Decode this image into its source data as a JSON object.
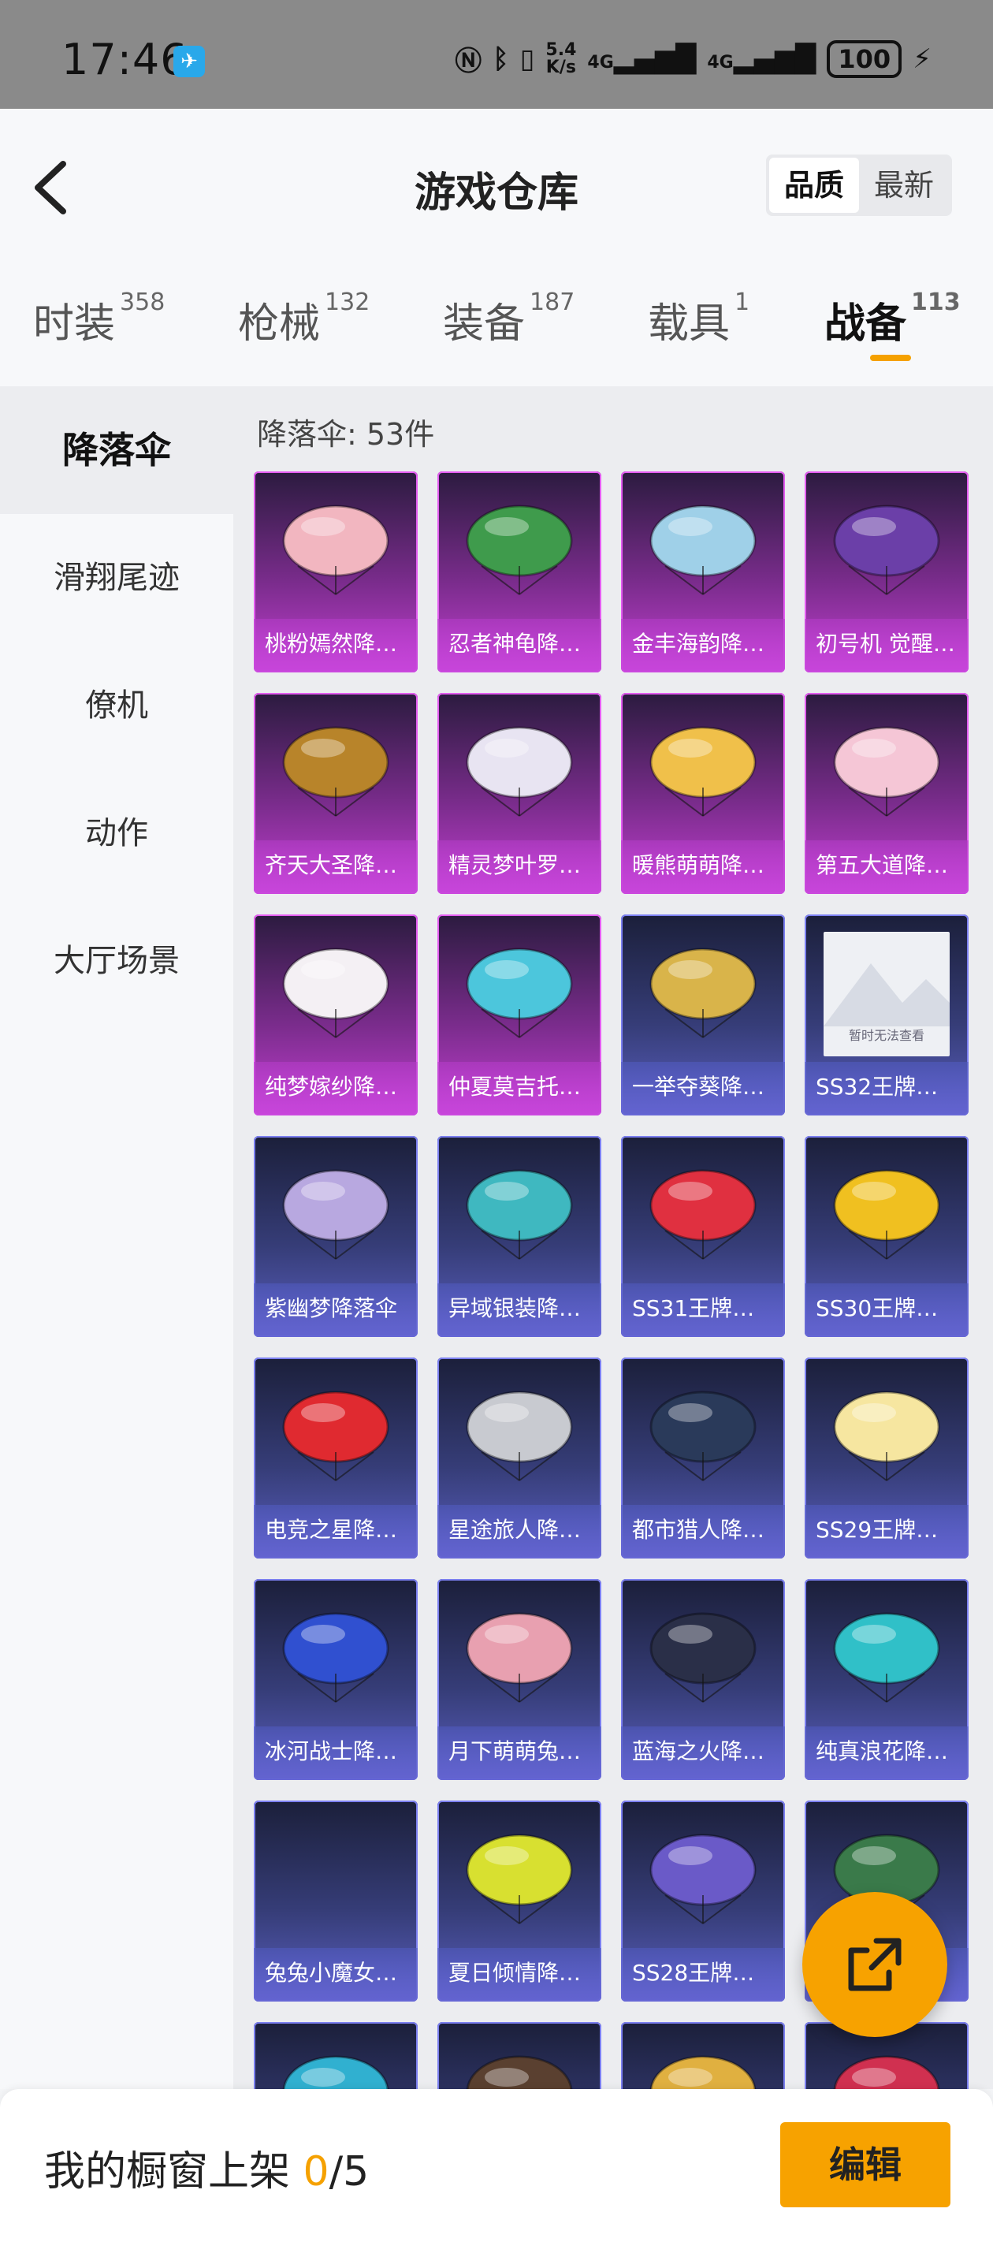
{
  "status_bar": {
    "time": "17:46",
    "net_speed_value": "5.4",
    "net_speed_unit": "K/s",
    "signal1": "4G",
    "signal2": "4G",
    "battery": "100"
  },
  "header": {
    "title": "游戏仓库",
    "sort_options": [
      "品质",
      "最新"
    ],
    "sort_active": "品质"
  },
  "tabs": [
    {
      "label": "时装",
      "count": "358"
    },
    {
      "label": "枪械",
      "count": "132"
    },
    {
      "label": "装备",
      "count": "187"
    },
    {
      "label": "载具",
      "count": "1"
    },
    {
      "label": "战备",
      "count": "113",
      "active": true
    }
  ],
  "sidebar": {
    "items": [
      {
        "label": "降落伞",
        "active": true
      },
      {
        "label": "滑翔尾迹"
      },
      {
        "label": "僚机"
      },
      {
        "label": "动作"
      },
      {
        "label": "大厅场景"
      }
    ]
  },
  "content": {
    "count_label": "降落伞: 53件",
    "placeholder_text": "暂时无法查看",
    "items": [
      {
        "name": "桃粉嫣然降…",
        "rarity": "purple",
        "color": "#f2b6c0"
      },
      {
        "name": "忍者神龟降…",
        "rarity": "purple",
        "color": "#3f9b4c"
      },
      {
        "name": "金丰海韵降…",
        "rarity": "purple",
        "color": "#9fd0e8"
      },
      {
        "name": "初号机 觉醒…",
        "rarity": "purple",
        "color": "#6b3fa8"
      },
      {
        "name": "齐天大圣降…",
        "rarity": "purple",
        "color": "#b8842a"
      },
      {
        "name": "精灵梦叶罗…",
        "rarity": "purple",
        "color": "#e8e4f2"
      },
      {
        "name": "暖熊萌萌降…",
        "rarity": "purple",
        "color": "#f0c04a"
      },
      {
        "name": "第五大道降…",
        "rarity": "purple",
        "color": "#f5c6d6"
      },
      {
        "name": "纯梦嫁纱降…",
        "rarity": "purple",
        "color": "#f4f0f4"
      },
      {
        "name": "仲夏莫吉托…",
        "rarity": "purple",
        "color": "#4cc6dc"
      },
      {
        "name": "一举夺葵降…",
        "rarity": "blue",
        "color": "#d9b44a"
      },
      {
        "name": "SS32王牌降…",
        "rarity": "blue",
        "placeholder": true
      },
      {
        "name": "紫幽梦降落伞",
        "rarity": "blue",
        "color": "#b8a8e0"
      },
      {
        "name": "异域银装降…",
        "rarity": "blue",
        "color": "#3fb8c0"
      },
      {
        "name": "SS31王牌降…",
        "rarity": "blue",
        "color": "#e03040"
      },
      {
        "name": "SS30王牌降…",
        "rarity": "blue",
        "color": "#f0c020"
      },
      {
        "name": "电竞之星降…",
        "rarity": "blue",
        "color": "#e02a30"
      },
      {
        "name": "星途旅人降…",
        "rarity": "blue",
        "color": "#c8cad0"
      },
      {
        "name": "都市猎人降…",
        "rarity": "blue",
        "color": "#2a3a5a"
      },
      {
        "name": "SS29王牌降…",
        "rarity": "blue",
        "color": "#f6e6a0"
      },
      {
        "name": "冰河战士降…",
        "rarity": "blue",
        "color": "#3050d0"
      },
      {
        "name": "月下萌萌兔…",
        "rarity": "blue",
        "color": "#e8a0b0"
      },
      {
        "name": "蓝海之火降…",
        "rarity": "blue",
        "color": "#2a2f48"
      },
      {
        "name": "纯真浪花降…",
        "rarity": "blue",
        "color": "#30c0c8"
      },
      {
        "name": "兔兔小魔女…",
        "rarity": "blue",
        "color": ""
      },
      {
        "name": "夏日倾情降…",
        "rarity": "blue",
        "color": "#d8e030"
      },
      {
        "name": "SS28王牌降…",
        "rarity": "blue",
        "color": "#6a5ac8"
      },
      {
        "name": "",
        "rarity": "blue",
        "color": "#3a7a4a"
      },
      {
        "name": "",
        "rarity": "blue",
        "color": "#30b0d0"
      },
      {
        "name": "",
        "rarity": "blue",
        "color": "#5a4030"
      },
      {
        "name": "",
        "rarity": "blue",
        "color": "#e0b040"
      },
      {
        "name": "",
        "rarity": "blue",
        "color": "#d03050"
      }
    ]
  },
  "bottom": {
    "shelf_label": "我的橱窗上架",
    "shelf_current": "0",
    "shelf_total": "/5",
    "edit_label": "编辑"
  },
  "colors": {
    "accent": "#f7a200"
  }
}
